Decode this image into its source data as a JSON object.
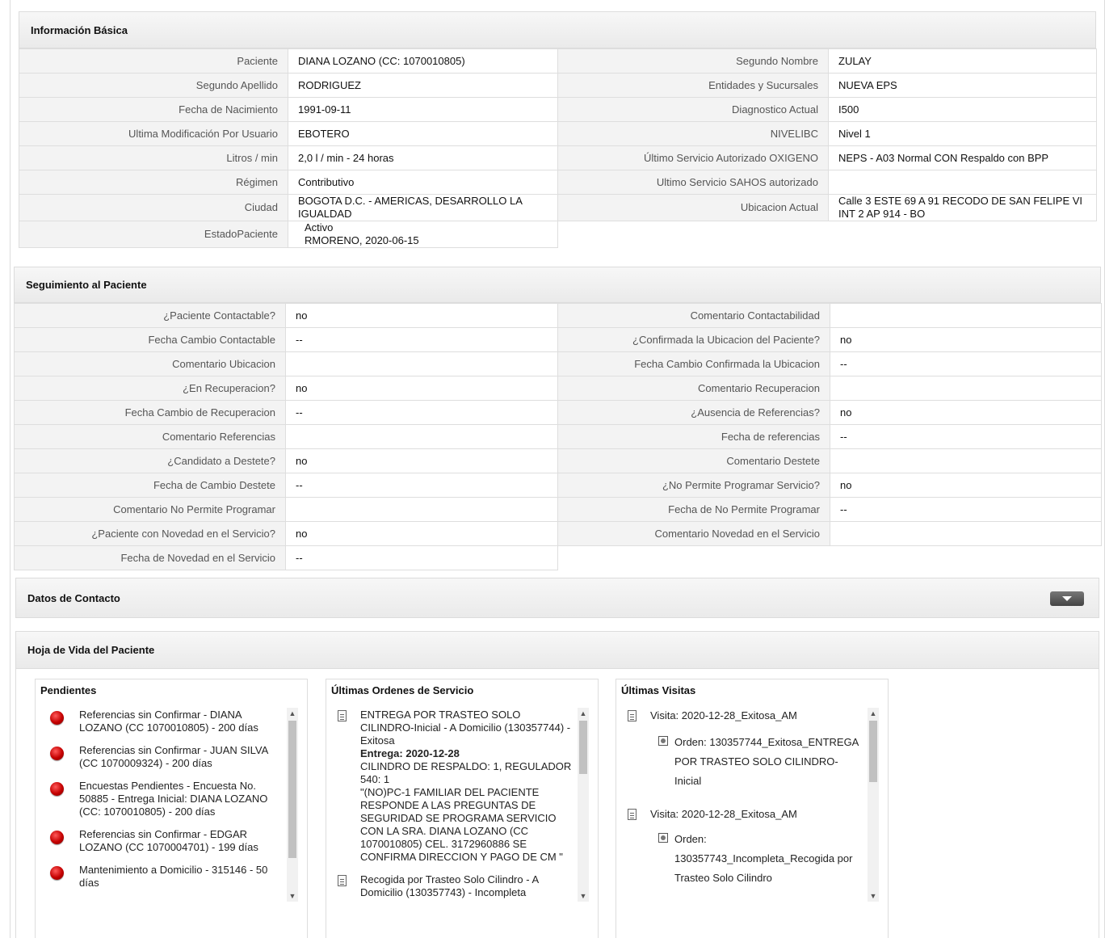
{
  "basic": {
    "title": "Información Básica",
    "rows": [
      {
        "l1": "Paciente",
        "v1": "DIANA LOZANO (CC: 1070010805)",
        "l2": "Segundo Nombre",
        "v2": "ZULAY"
      },
      {
        "l1": "Segundo Apellido",
        "v1": "RODRIGUEZ",
        "l2": "Entidades y Sucursales",
        "v2": "NUEVA EPS"
      },
      {
        "l1": "Fecha de Nacimiento",
        "v1": "1991-09-11",
        "l2": "Diagnostico Actual",
        "v2": "I500"
      },
      {
        "l1": "Ultima Modificación Por Usuario",
        "v1": "EBOTERO",
        "l2": "NIVELIBC",
        "v2": "Nivel 1"
      },
      {
        "l1": "Litros / min",
        "v1": "2,0 l / min - 24 horas",
        "l2": "Último Servicio Autorizado OXIGENO",
        "v2": "NEPS - A03 Normal CON Respaldo con BPP"
      },
      {
        "l1": "Régimen",
        "v1": "Contributivo",
        "l2": "Ultimo Servicio SAHOS autorizado",
        "v2": ""
      },
      {
        "l1": "Ciudad",
        "v1": "BOGOTA D.C. - AMERICAS, DESARROLLO LA IGUALDAD",
        "l2": "Ubicacion Actual",
        "v2": "Calle 3 ESTE 69 A 91 RECODO DE SAN FELIPE VI INT 2 AP 914 - BO"
      },
      {
        "l1": "EstadoPaciente",
        "v1a": "Activo",
        "v1b": "RMORENO, 2020-06-15"
      }
    ]
  },
  "seguimiento": {
    "title": "Seguimiento al Paciente",
    "rows": [
      {
        "l1": "¿Paciente Contactable?",
        "v1": "no",
        "l2": "Comentario Contactabilidad",
        "v2": ""
      },
      {
        "l1": "Fecha Cambio Contactable",
        "v1": "--",
        "l2": "¿Confirmada la Ubicacion del Paciente?",
        "v2": "no"
      },
      {
        "l1": "Comentario Ubicacion",
        "v1": "",
        "l2": "Fecha Cambio Confirmada la Ubicacion",
        "v2": "--"
      },
      {
        "l1": "¿En Recuperacion?",
        "v1": "no",
        "l2": "Comentario Recuperacion",
        "v2": ""
      },
      {
        "l1": "Fecha Cambio de Recuperacion",
        "v1": "--",
        "l2": "¿Ausencia de Referencias?",
        "v2": "no"
      },
      {
        "l1": "Comentario Referencias",
        "v1": "",
        "l2": "Fecha de referencias",
        "v2": "--"
      },
      {
        "l1": "¿Candidato a Destete?",
        "v1": "no",
        "l2": "Comentario Destete",
        "v2": ""
      },
      {
        "l1": "Fecha de Cambio Destete",
        "v1": "--",
        "l2": "¿No Permite Programar Servicio?",
        "v2": "no"
      },
      {
        "l1": "Comentario No Permite Programar",
        "v1": "",
        "l2": "Fecha de No Permite Programar",
        "v2": "--"
      },
      {
        "l1": "¿Paciente con Novedad en el Servicio?",
        "v1": "no",
        "l2": "Comentario Novedad en el Servicio",
        "v2": ""
      },
      {
        "l1": "Fecha de Novedad en el Servicio",
        "v1": "--"
      }
    ]
  },
  "contacto": {
    "title": "Datos de Contacto",
    "toggle_icon": "chevron-down-icon"
  },
  "hoja": {
    "title": "Hoja de Vida del Paciente",
    "pendientes": {
      "title": "Pendientes",
      "items": [
        "Referencias sin Confirmar - DIANA LOZANO (CC 1070010805) - 200 días",
        "Referencias sin Confirmar - JUAN SILVA (CC 1070009324) - 200 días",
        "Encuestas Pendientes - Encuesta No. 50885 - Entrega Inicial: DIANA LOZANO (CC: 1070010805) - 200 días",
        "Referencias sin Confirmar - EDGAR LOZANO (CC 1070004701) - 199 días",
        "Mantenimiento a Domicilio - 315146 - 50 días"
      ]
    },
    "ordenes": {
      "title": "Últimas Ordenes de Servicio",
      "items": [
        {
          "head": "ENTREGA POR TRASTEO SOLO CILINDRO-Inicial - A Domicilio (130357744) - Exitosa",
          "entrega_label": "Entrega: 2020-12-28",
          "detail": "CILINDRO DE RESPALDO: 1, REGULADOR 540: 1",
          "note": "\"(NO)PC-1 FAMILIAR DEL PACIENTE RESPONDE A LAS PREGUNTAS DE SEGURIDAD SE PROGRAMA SERVICIO CON LA SRA. DIANA LOZANO (CC 1070010805) CEL. 3172960886 SE CONFIRMA DIRECCION Y PAGO DE CM \""
        },
        {
          "head": "Recogida por Trasteo Solo Cilindro - A Domicilio (130357743) - Incompleta"
        }
      ]
    },
    "visitas": {
      "title": "Últimas Visitas",
      "items": [
        {
          "visita": "Visita: 2020-12-28_Exitosa_AM",
          "orden": "Orden: 130357744_Exitosa_ENTREGA POR TRASTEO SOLO CILINDRO-Inicial"
        },
        {
          "visita": "Visita: 2020-12-28_Exitosa_AM",
          "orden": "Orden: 130357743_Incompleta_Recogida por Trasteo Solo Cilindro"
        }
      ]
    }
  }
}
